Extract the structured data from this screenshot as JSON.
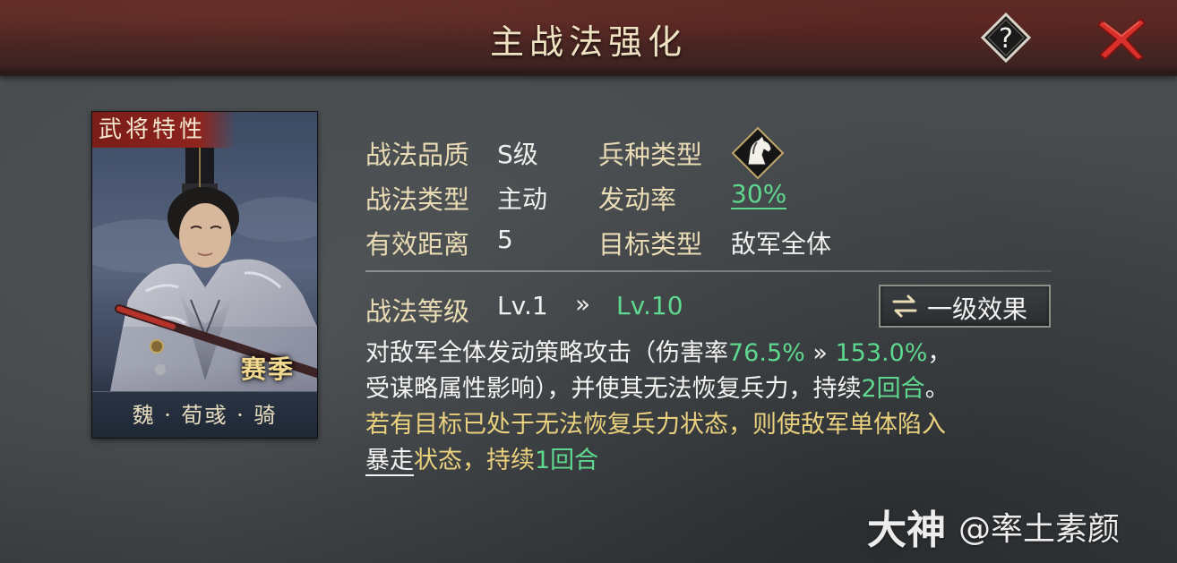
{
  "title": "主战法强化",
  "header": {
    "help_icon": "question-diamond-icon",
    "close_icon": "close-x-icon",
    "close_color": "#d9302c"
  },
  "card": {
    "tag": "武将特性",
    "season": "赛季",
    "footer": "魏 · 荀彧 · 骑"
  },
  "info": {
    "quality_label": "战法品质",
    "quality_value": "S级",
    "troop_label": "兵种类型",
    "troop_icon": "cavalry-horse-icon",
    "type_label": "战法类型",
    "type_value": "主动",
    "rate_label": "发动率",
    "rate_value": "30%",
    "range_label": "有效距离",
    "range_value": "5",
    "target_label": "目标类型",
    "target_value": "敌军全体"
  },
  "level": {
    "label": "战法等级",
    "current": "Lv.1",
    "arrow": "»",
    "next": "Lv.10",
    "effect_button": "一级效果",
    "effect_icon": "swap-arrows-icon"
  },
  "description": {
    "l1_a": "对敌军全体发动策略攻击（伤害率",
    "l1_b": "76.5%",
    "l1_c": " » ",
    "l1_d": "153.0%",
    "l1_e": "，",
    "l2_a": "受谋略属性影响），并使其无法恢复兵力，持续",
    "l2_b": "2回合",
    "l2_c": "。",
    "l3_a": "若有目标已处于无法恢复兵力状态，则使敌军单体陷入",
    "l4_a": "暴走",
    "l4_b": "状态，持续",
    "l4_c": "1回合"
  },
  "watermark": {
    "brand": "大神",
    "user": "@率土素颜"
  },
  "colors": {
    "label": "#e9dcb4",
    "value": "#f0f0ee",
    "highlight_green": "#5fd88f",
    "highlight_yellow": "#ead17e",
    "title": "#efe2c2"
  }
}
